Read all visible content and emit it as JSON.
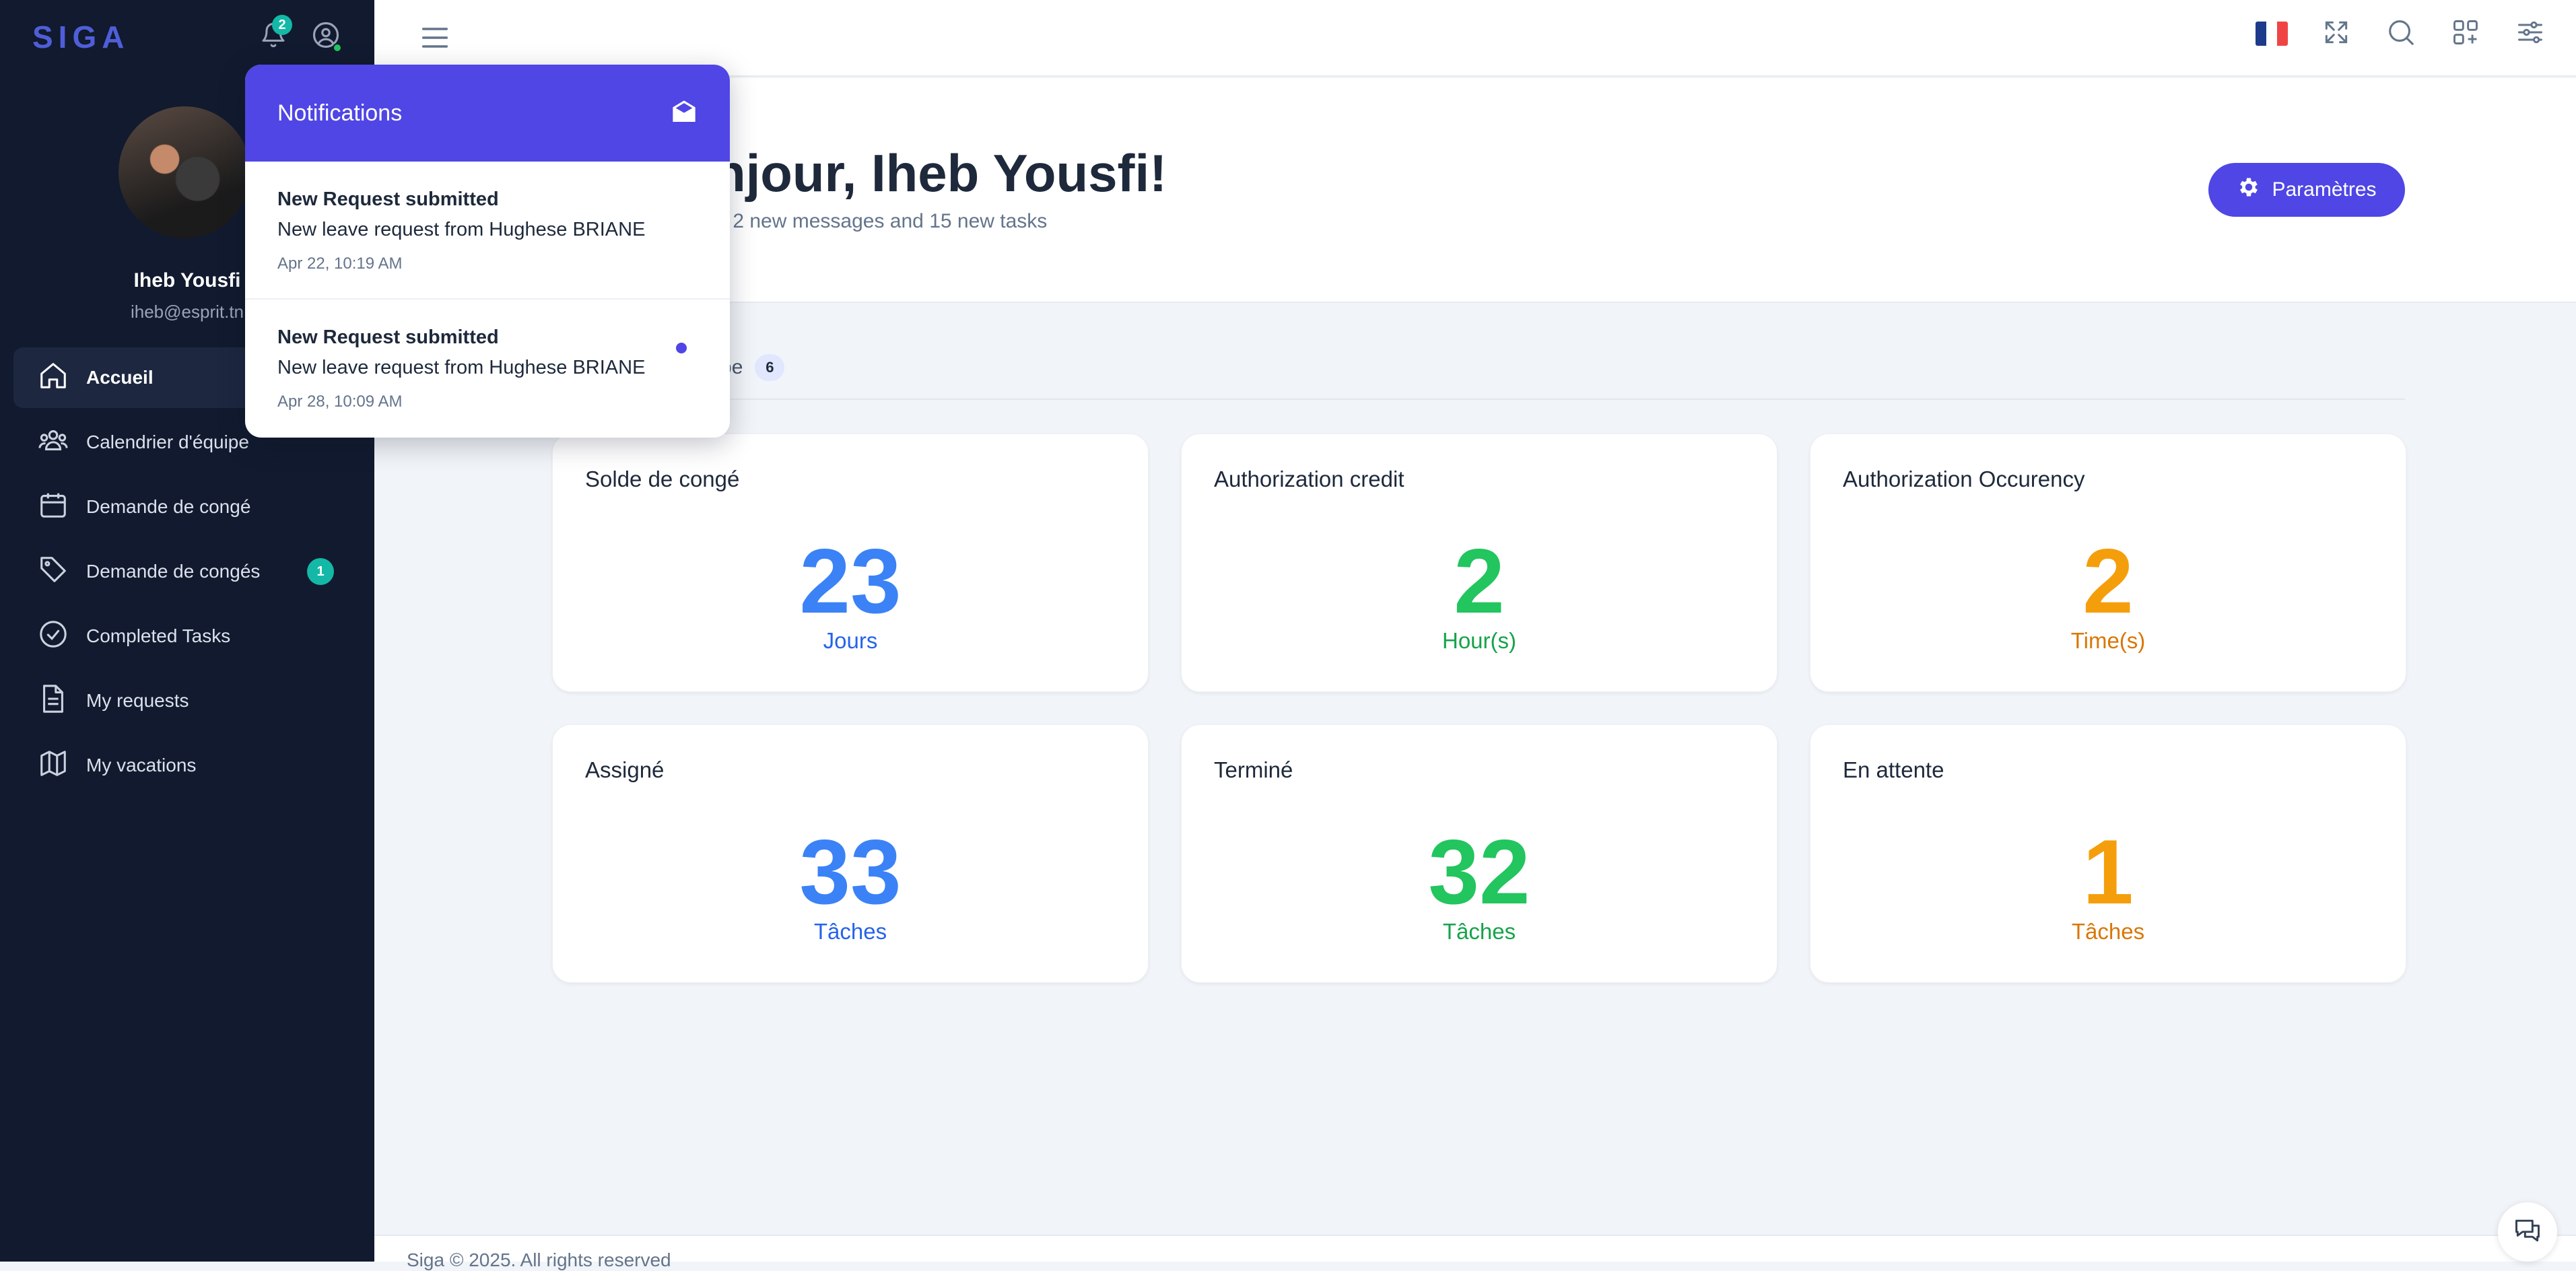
{
  "brand": {
    "logo_text": "SIGA"
  },
  "header": {
    "notification_count": "2"
  },
  "user": {
    "name": "Iheb Yousfi",
    "email": "iheb@esprit.tn"
  },
  "sidebar": {
    "items": [
      {
        "label": "Accueil",
        "icon": "home-icon"
      },
      {
        "label": "Calendrier d'équipe",
        "icon": "users-icon"
      },
      {
        "label": "Demande de congé",
        "icon": "calendar-icon"
      },
      {
        "label": "Demande de congés",
        "icon": "tag-icon",
        "badge": "1"
      },
      {
        "label": "Completed Tasks",
        "icon": "check-circle-icon"
      },
      {
        "label": "My requests",
        "icon": "file-icon"
      },
      {
        "label": "My vacations",
        "icon": "map-icon"
      }
    ]
  },
  "hero": {
    "title": "Bonjour, Iheb Yousfi!",
    "subtitle": "You have 2 new messages and 15 new tasks",
    "settings_label": "Paramètres"
  },
  "tabs": {
    "active_label": "Équipe",
    "active_count": "6"
  },
  "cards": [
    {
      "label": "Solde de congé",
      "value": "23",
      "unit": "Jours"
    },
    {
      "label": "Authorization credit",
      "value": "2",
      "unit": "Hour(s)"
    },
    {
      "label": "Authorization Occurency",
      "value": "2",
      "unit": "Time(s)"
    },
    {
      "label": "Assigné",
      "value": "33",
      "unit": "Tâches"
    },
    {
      "label": "Terminé",
      "value": "32",
      "unit": "Tâches"
    },
    {
      "label": "En attente",
      "value": "1",
      "unit": "Tâches"
    }
  ],
  "notifications": {
    "title": "Notifications",
    "items": [
      {
        "title": "New Request submitted",
        "body": "New leave request from Hughese BRIANE",
        "time": "Apr 22, 10:19 AM",
        "unread": false
      },
      {
        "title": "New Request submitted",
        "body": "New leave request from Hughese BRIANE",
        "time": "Apr 28, 10:09 AM",
        "unread": true
      }
    ]
  },
  "footer": {
    "text": "Siga © 2025. All rights reserved"
  },
  "colors": {
    "accent": "#4f46e5",
    "sidebar_bg": "#111a2e",
    "teal_badge": "#14b8a6",
    "blue": "#3b82f6",
    "green": "#22c55e",
    "orange": "#f59e0b"
  }
}
